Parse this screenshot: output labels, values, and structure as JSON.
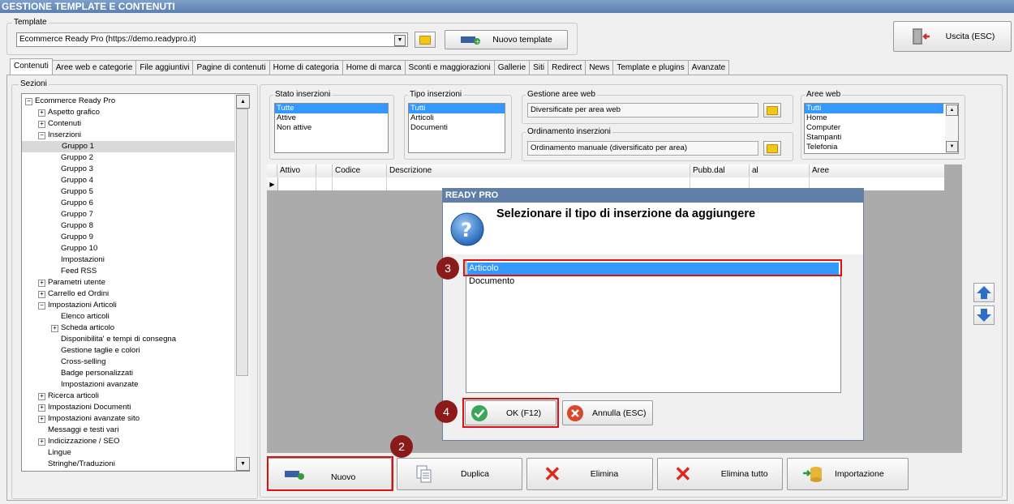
{
  "window": {
    "title": "GESTIONE TEMPLATE E CONTENUTI"
  },
  "template_group": {
    "label": "Template",
    "selected": "Ecommerce Ready Pro (https://demo.readypro.it)",
    "new_button": "Nuovo template"
  },
  "exit_button": "Uscita (ESC)",
  "tabs": [
    "Contenuti",
    "Aree web e categorie",
    "File aggiuntivi",
    "Pagine di contenuti",
    "Home di categoria",
    "Home di marca",
    "Sconti e maggiorazioni",
    "Gallerie",
    "Siti",
    "Redirect",
    "News",
    "Template e plugins",
    "Avanzate"
  ],
  "sections": {
    "label": "Sezioni",
    "items": [
      {
        "text": "Ecommerce Ready Pro",
        "level": 0,
        "expander": "−",
        "selected": false
      },
      {
        "text": "Aspetto grafico",
        "level": 1,
        "expander": "+",
        "selected": false
      },
      {
        "text": "Contenuti",
        "level": 1,
        "expander": "+",
        "selected": false
      },
      {
        "text": "Inserzioni",
        "level": 1,
        "expander": "−",
        "selected": false
      },
      {
        "text": "Gruppo 1",
        "level": 2,
        "expander": "",
        "selected": true
      },
      {
        "text": "Gruppo 2",
        "level": 2,
        "expander": "",
        "selected": false
      },
      {
        "text": "Gruppo 3",
        "level": 2,
        "expander": "",
        "selected": false
      },
      {
        "text": "Gruppo 4",
        "level": 2,
        "expander": "",
        "selected": false
      },
      {
        "text": "Gruppo 5",
        "level": 2,
        "expander": "",
        "selected": false
      },
      {
        "text": "Gruppo 6",
        "level": 2,
        "expander": "",
        "selected": false
      },
      {
        "text": "Gruppo 7",
        "level": 2,
        "expander": "",
        "selected": false
      },
      {
        "text": "Gruppo 8",
        "level": 2,
        "expander": "",
        "selected": false
      },
      {
        "text": "Gruppo 9",
        "level": 2,
        "expander": "",
        "selected": false
      },
      {
        "text": "Gruppo 10",
        "level": 2,
        "expander": "",
        "selected": false
      },
      {
        "text": "Impostazioni",
        "level": 2,
        "expander": "",
        "selected": false
      },
      {
        "text": "Feed RSS",
        "level": 2,
        "expander": "",
        "selected": false
      },
      {
        "text": "Parametri utente",
        "level": 1,
        "expander": "+",
        "selected": false
      },
      {
        "text": "Carrello ed Ordini",
        "level": 1,
        "expander": "+",
        "selected": false
      },
      {
        "text": "Impostazioni Articoli",
        "level": 1,
        "expander": "−",
        "selected": false
      },
      {
        "text": "Elenco articoli",
        "level": 2,
        "expander": "",
        "selected": false
      },
      {
        "text": "Scheda articolo",
        "level": 2,
        "expander": "+",
        "selected": false
      },
      {
        "text": "Disponibilita' e tempi di consegna",
        "level": 2,
        "expander": "",
        "selected": false
      },
      {
        "text": "Gestione taglie e colori",
        "level": 2,
        "expander": "",
        "selected": false
      },
      {
        "text": "Cross-selling",
        "level": 2,
        "expander": "",
        "selected": false
      },
      {
        "text": "Badge personalizzati",
        "level": 2,
        "expander": "",
        "selected": false
      },
      {
        "text": "Impostazioni avanzate",
        "level": 2,
        "expander": "",
        "selected": false
      },
      {
        "text": "Ricerca articoli",
        "level": 1,
        "expander": "+",
        "selected": false
      },
      {
        "text": "Impostazioni Documenti",
        "level": 1,
        "expander": "+",
        "selected": false
      },
      {
        "text": "Impostazioni avanzate sito",
        "level": 1,
        "expander": "+",
        "selected": false
      },
      {
        "text": "Messaggi e testi vari",
        "level": 1,
        "expander": "",
        "selected": false
      },
      {
        "text": "Indicizzazione / SEO",
        "level": 1,
        "expander": "+",
        "selected": false
      },
      {
        "text": "Lingue",
        "level": 1,
        "expander": "",
        "selected": false
      },
      {
        "text": "Stringhe/Traduzioni",
        "level": 1,
        "expander": "",
        "selected": false
      }
    ]
  },
  "filters": {
    "stato": {
      "label": "Stato inserzioni",
      "options": [
        "Tutte",
        "Attive",
        "Non attive"
      ],
      "selected": 0
    },
    "tipo": {
      "label": "Tipo inserzioni",
      "options": [
        "Tutti",
        "Articoli",
        "Documenti"
      ],
      "selected": 0
    },
    "gestione": {
      "label": "Gestione aree web",
      "value": "Diversificate per area web"
    },
    "ordinamento": {
      "label": "Ordinamento inserzioni",
      "value": "Ordinamento manuale (diversificato per area)"
    },
    "aree": {
      "label": "Aree web",
      "options": [
        "Tutti",
        "Home",
        "Computer",
        "Stampanti",
        "Telefonia"
      ],
      "selected": 0
    }
  },
  "grid": {
    "columns": [
      "Attivo",
      "",
      "Codice",
      "Descrizione",
      "Pubb.dal",
      "al",
      "Aree"
    ]
  },
  "dialog": {
    "title": "READY PRO",
    "message": "Selezionare il tipo di inserzione da aggiungere",
    "options": [
      "Articolo",
      "Documento"
    ],
    "selected": 0,
    "ok": "OK (F12)",
    "cancel": "Annulla (ESC)"
  },
  "markers": [
    "2",
    "3",
    "4"
  ],
  "bottom_buttons": {
    "nuovo": "Nuovo",
    "duplica": "Duplica",
    "elimina": "Elimina",
    "elimina_tutto": "Elimina tutto",
    "importazione": "Importazione"
  },
  "colors": {
    "highlight": "#e01010",
    "marker": "#8b1a1a",
    "selection": "#3399ff"
  }
}
